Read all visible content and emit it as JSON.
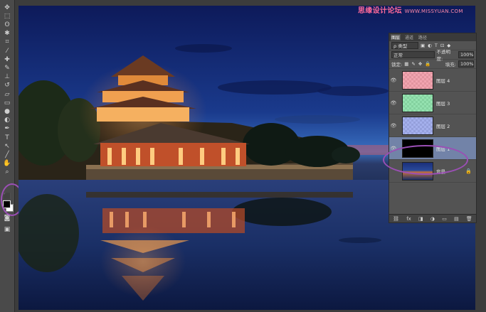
{
  "watermark": {
    "text": "思缘设计论坛",
    "url": "WWW.MISSYUAN.COM"
  },
  "toolbar": {
    "tools": [
      {
        "name": "move-tool-icon",
        "glyph": "✥"
      },
      {
        "name": "marquee-tool-icon",
        "glyph": "⬚"
      },
      {
        "name": "lasso-tool-icon",
        "glyph": "ʘ"
      },
      {
        "name": "magic-wand-tool-icon",
        "glyph": "✱"
      },
      {
        "name": "crop-tool-icon",
        "glyph": "⌗"
      },
      {
        "name": "eyedropper-tool-icon",
        "glyph": "⁄"
      },
      {
        "name": "healing-brush-tool-icon",
        "glyph": "✚"
      },
      {
        "name": "brush-tool-icon",
        "glyph": "✎"
      },
      {
        "name": "stamp-tool-icon",
        "glyph": "⊥"
      },
      {
        "name": "history-brush-tool-icon",
        "glyph": "↺"
      },
      {
        "name": "eraser-tool-icon",
        "glyph": "▱"
      },
      {
        "name": "gradient-tool-icon",
        "glyph": "▭"
      },
      {
        "name": "blur-tool-icon",
        "glyph": "●"
      },
      {
        "name": "dodge-tool-icon",
        "glyph": "◐"
      },
      {
        "name": "pen-tool-icon",
        "glyph": "✒"
      },
      {
        "name": "type-tool-icon",
        "glyph": "T"
      },
      {
        "name": "path-selection-tool-icon",
        "glyph": "↖"
      },
      {
        "name": "line-tool-icon",
        "glyph": "╱"
      },
      {
        "name": "hand-tool-icon",
        "glyph": "✋"
      },
      {
        "name": "zoom-tool-icon",
        "glyph": "⌕"
      }
    ],
    "default_colors_icon": "⬛",
    "quick_mask_icon": "◙",
    "screen_mode_icon": "▣"
  },
  "layers_panel": {
    "tabs": [
      "图层",
      "通道",
      "路径"
    ],
    "active_tab": 0,
    "filter_label": "ρ 类型",
    "filter_icons": [
      "▣",
      "◐",
      "T",
      "⊡",
      "◆"
    ],
    "blend_mode": "正常",
    "opacity_label": "不透明度:",
    "opacity_value": "100%",
    "lock_label": "锁定:",
    "lock_icons": [
      "▦",
      "✎",
      "✥",
      "🔒"
    ],
    "fill_label": "填充:",
    "fill_value": "100%",
    "layers": [
      {
        "name": "图层 4",
        "thumb": "red",
        "visible": true,
        "selected": false,
        "locked": false
      },
      {
        "name": "图层 3",
        "thumb": "green",
        "visible": true,
        "selected": false,
        "locked": false
      },
      {
        "name": "图层 2",
        "thumb": "blue",
        "visible": true,
        "selected": false,
        "locked": false
      },
      {
        "name": "图层 1",
        "thumb": "black",
        "visible": true,
        "selected": true,
        "locked": false
      },
      {
        "name": "背景",
        "thumb": "photo",
        "visible": false,
        "selected": false,
        "locked": true
      }
    ],
    "bottom_icons": [
      "⛓",
      "fx",
      "◨",
      "◑",
      "▭",
      "▤",
      "🗑"
    ]
  },
  "colors": {
    "highlight_ring": "#9b4fb5",
    "selected_layer": "#7283a8",
    "watermark": "#ff6a9a"
  }
}
